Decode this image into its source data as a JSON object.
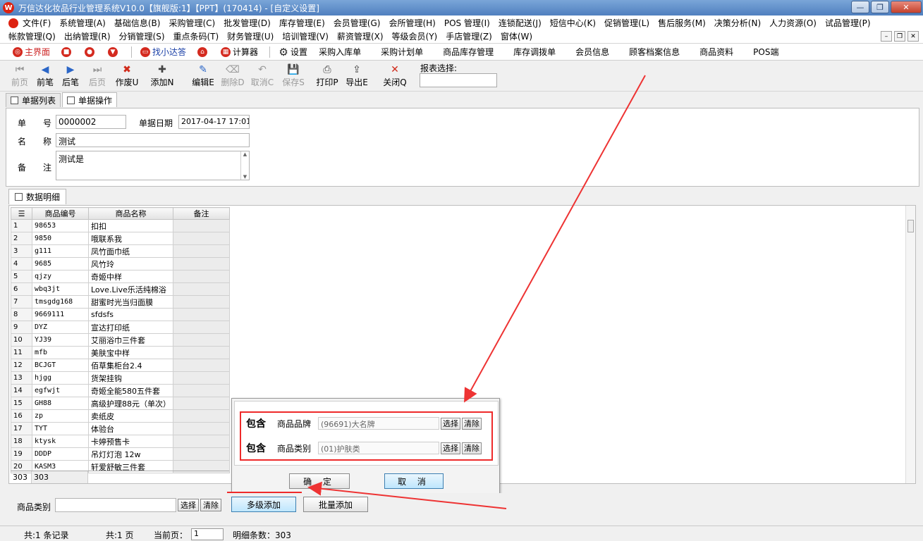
{
  "window": {
    "title": "万信达化妆品行业管理系统V10.0【旗舰版:1】【PPT】(170414) - [自定义设置]",
    "controls": [
      "—",
      "❐",
      "✕"
    ]
  },
  "menubar": {
    "row1": [
      "文件(F)",
      "系统管理(A)",
      "基础信息(B)",
      "采购管理(C)",
      "批发管理(D)",
      "库存管理(E)",
      "会员管理(G)",
      "会所管理(H)",
      "POS 管理(I)",
      "连锁配送(J)",
      "短信中心(K)",
      "促销管理(L)",
      "售后服务(M)",
      "决策分析(N)",
      "人力资源(O)",
      "试品管理(P)"
    ],
    "row2": [
      "帐款管理(Q)",
      "出纳管理(R)",
      "分销管理(S)",
      "重点条码(T)",
      "财务管理(U)",
      "培训管理(V)",
      "薪资管理(X)",
      "等级会员(Y)",
      "手店管理(Z)",
      "窗体(W)"
    ],
    "mdi_controls": [
      "–",
      "❐",
      "✕"
    ]
  },
  "quickbar": {
    "main": "主界面",
    "find": "找小达答",
    "calc": "计算器",
    "settings": "设置",
    "links": [
      "采购入库单",
      "采购计划单",
      "商品库存管理",
      "库存调拨单",
      "会员信息",
      "顾客档案信息",
      "商品资料",
      "POS端"
    ]
  },
  "toolbar": {
    "buttons": [
      {
        "label": "前页",
        "icon": "⏮",
        "disabled": true
      },
      {
        "label": "前笔",
        "icon": "◀",
        "disabled": false
      },
      {
        "label": "后笔",
        "icon": "▶",
        "disabled": false
      },
      {
        "label": "后页",
        "icon": "⏭",
        "disabled": true
      },
      {
        "label": "作废U",
        "icon": "✖",
        "disabled": false
      },
      {
        "label": "添加N",
        "icon": "✚",
        "disabled": false
      },
      {
        "label": "编辑E",
        "icon": "✎",
        "disabled": false
      },
      {
        "label": "删除D",
        "icon": "⌫",
        "disabled": true
      },
      {
        "label": "取消C",
        "icon": "↶",
        "disabled": true
      },
      {
        "label": "保存S",
        "icon": "💾",
        "disabled": true
      },
      {
        "label": "打印P",
        "icon": "⎙",
        "disabled": false
      },
      {
        "label": "导出E",
        "icon": "⇪",
        "disabled": false
      },
      {
        "label": "关闭Q",
        "icon": "✕",
        "disabled": false
      }
    ],
    "report_label": "报表选择:",
    "report_value": ""
  },
  "tabs": {
    "list": "单据列表",
    "operation": "单据操作",
    "detail": "数据明细"
  },
  "form": {
    "no_label": "单　　号",
    "no_value": "0000002",
    "date_label": "单据日期",
    "date_value": "2017-04-17 17:01",
    "name_label": "名　　称",
    "name_value": "测试",
    "remark_label": "备　　注",
    "remark_value": "测试是"
  },
  "grid": {
    "headers": [
      "商品编号",
      "商品名称",
      "备注"
    ],
    "rows": [
      [
        "1",
        "98653",
        "扣扣"
      ],
      [
        "2",
        "9850",
        "哦联系我"
      ],
      [
        "3",
        "g111",
        "凤竹面巾纸"
      ],
      [
        "4",
        "9685",
        "风竹玲"
      ],
      [
        "5",
        "qjzy",
        "奇姬中样"
      ],
      [
        "6",
        "wbq3jt",
        "Love.Live乐活纯棉浴"
      ],
      [
        "7",
        "tmsgdg168",
        "甜蜜时光当归面膜"
      ],
      [
        "8",
        "9669111",
        "sfdsfs"
      ],
      [
        "9",
        "DYZ",
        "宣达打印纸"
      ],
      [
        "10",
        "YJ39",
        "艾丽浴巾三件套"
      ],
      [
        "11",
        "mfb",
        "美肤宝中样"
      ],
      [
        "12",
        "BCJGT",
        "佰草集柜台2.4"
      ],
      [
        "13",
        "hjgg",
        "货架挂钩"
      ],
      [
        "14",
        "egfwjt",
        "奇姬全能580五件套"
      ],
      [
        "15",
        "GH88",
        "高级护理88元（单次）"
      ],
      [
        "16",
        "zp",
        "卖纸皮"
      ],
      [
        "17",
        "TYT",
        "体验台"
      ],
      [
        "18",
        "ktysk",
        "卡婷预售卡"
      ],
      [
        "19",
        "DDDP",
        "吊灯灯泡 12w"
      ],
      [
        "20",
        "KASM3",
        "轩爱舒敏三件套"
      ]
    ],
    "footer_count": "303",
    "footer_count2": "303"
  },
  "popup": {
    "include1": "包含",
    "brand_label": "商品品牌",
    "brand_value": "(96691)大名牌",
    "include2": "包含",
    "category_label": "商品类别",
    "category_value": "(01)护肤类",
    "select": "选择",
    "clear": "清除",
    "ok": "确 定",
    "cancel": "取 消"
  },
  "bottom": {
    "category_label": "商品类别",
    "select": "选择",
    "clear": "清除",
    "multi_add": "多级添加",
    "batch_add": "批量添加"
  },
  "status": {
    "records": "共:1 条记录",
    "pages": "共:1 页",
    "current_label": "当前页：",
    "current_value": "1",
    "detail_count": "明细条数：303"
  },
  "colors": {
    "highlight": "#ee2a2a",
    "accent_red": "#d42a1f",
    "link_blue": "#1a3fa6"
  }
}
